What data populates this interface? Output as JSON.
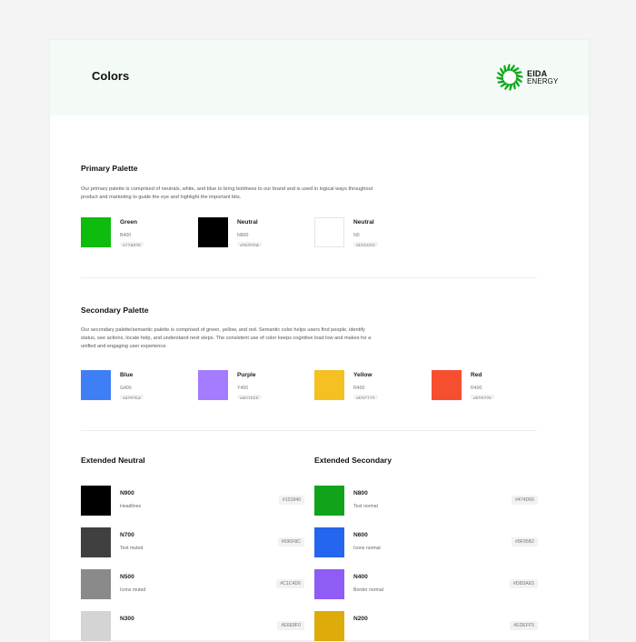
{
  "header": {
    "title": "Colors",
    "logo_top": "EIDA",
    "logo_bottom": "ENERGY",
    "logo_color": "#12a820"
  },
  "primary": {
    "title": "Primary Palette",
    "description": "Our primary palette is comprised of neutrals, white, and blue to bring boldness to our brand and is used in logical ways throughout product and marketing to guide the eye and highlight the important bits.",
    "items": [
      {
        "name": "Green",
        "code": "B400",
        "hex": "#12A82F",
        "color": "#0ebc0e"
      },
      {
        "name": "Neutral",
        "code": "N800",
        "hex": "#0F0D0A",
        "color": "#000000"
      },
      {
        "name": "Neutral",
        "code": "N0",
        "hex": "#FFFFFF",
        "color": "#ffffff"
      }
    ]
  },
  "secondary": {
    "title": "Secondary Palette",
    "description": "Our secondary palette/semantic palette is comprised of green, yellow, and red. Semantic color helps users find people, identify status, see actions, locate help, and understand next steps. The consistent use of color keeps cognitive load low and makes for a unified and engaging user experience.",
    "items": [
      {
        "name": "Blue",
        "code": "G400",
        "hex": "#4287F4",
        "color": "#3f7ff5"
      },
      {
        "name": "Purple",
        "code": "Y400",
        "hex": "#A57FFF",
        "color": "#a57bff"
      },
      {
        "name": "Yellow",
        "code": "R400",
        "hex": "#F5C123",
        "color": "#f5c022"
      },
      {
        "name": "Red",
        "code": "R400",
        "hex": "#F5522F",
        "color": "#f64f2f"
      }
    ]
  },
  "extended_neutral": {
    "title": "Extended Neutral",
    "items": [
      {
        "name": "N900",
        "desc": "Headlines",
        "hex": "#101840",
        "color": "#000000"
      },
      {
        "name": "N700",
        "desc": "Text muted",
        "hex": "#696F8C",
        "color": "#404040"
      },
      {
        "name": "N500",
        "desc": "Icons muted",
        "hex": "#C1C4D6",
        "color": "#8a8a8a"
      },
      {
        "name": "N300",
        "desc": "",
        "hex": "#E6E8F0",
        "color": "#d4d4d4"
      }
    ]
  },
  "extended_secondary": {
    "title": "Extended Secondary",
    "items": [
      {
        "name": "N800",
        "desc": "Text normal",
        "hex": "#474D66",
        "color": "#11a31a"
      },
      {
        "name": "N600",
        "desc": "Icons normal",
        "hex": "#8F95B2",
        "color": "#2466ed"
      },
      {
        "name": "N400",
        "desc": "Border normal",
        "hex": "#D8DAE5",
        "color": "#8f5cf6"
      },
      {
        "name": "N200",
        "desc": "",
        "hex": "#EDEFF5",
        "color": "#ddac0a"
      }
    ]
  }
}
